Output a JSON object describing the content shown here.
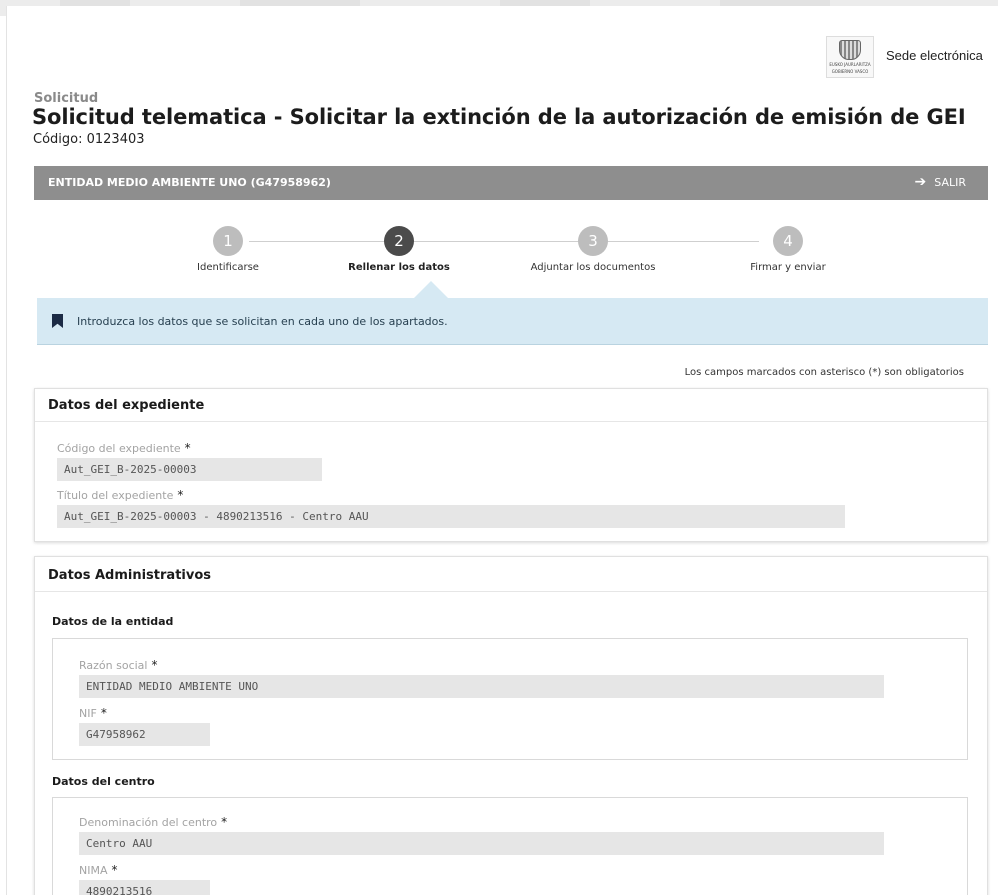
{
  "header": {
    "sede_label": "Sede electrónica",
    "logo_text_1": "EUSKO JAURLARITZA",
    "logo_text_2": "GOBIERNO VASCO"
  },
  "page": {
    "crumb": "Solicitud",
    "title": "Solicitud telematica - Solicitar la extinción de la autorización de emisión de GEI",
    "code": "Código: 0123403"
  },
  "entity_bar": {
    "name": "ENTIDAD MEDIO AMBIENTE UNO (G47958962)",
    "logout_label": "SALIR",
    "logout_icon": "sign-out-icon"
  },
  "steps": [
    {
      "num": "1",
      "label": "Identificarse",
      "state": "done"
    },
    {
      "num": "2",
      "label": "Rellenar los datos",
      "state": "active"
    },
    {
      "num": "3",
      "label": "Adjuntar los documentos",
      "state": "pending"
    },
    {
      "num": "4",
      "label": "Firmar y enviar",
      "state": "pending"
    }
  ],
  "info": {
    "icon": "bookmark-icon",
    "text": "Introduzca los datos que se solicitan en cada uno de los apartados.",
    "color": "#d6e9f3"
  },
  "required_note": "Los campos marcados con asterisco (*) son obligatorios",
  "expediente": {
    "heading": "Datos del expediente",
    "codigo_label": "Código del expediente",
    "codigo_value": "Aut_GEI_B-2025-00003",
    "titulo_label": "Título del expediente",
    "titulo_value": "Aut_GEI_B-2025-00003 - 4890213516 - Centro AAU",
    "asterisk": "*"
  },
  "administrativos": {
    "heading": "Datos Administrativos",
    "entidad": {
      "heading": "Datos de la entidad",
      "razon_label": "Razón social",
      "razon_value": "ENTIDAD MEDIO AMBIENTE UNO",
      "nif_label": "NIF",
      "nif_value": "G47958962"
    },
    "centro": {
      "heading": "Datos del centro",
      "denominacion_label": "Denominación del centro",
      "denominacion_value": "Centro AAU",
      "nima_label": "NIMA",
      "nima_value": "4890213516"
    }
  }
}
